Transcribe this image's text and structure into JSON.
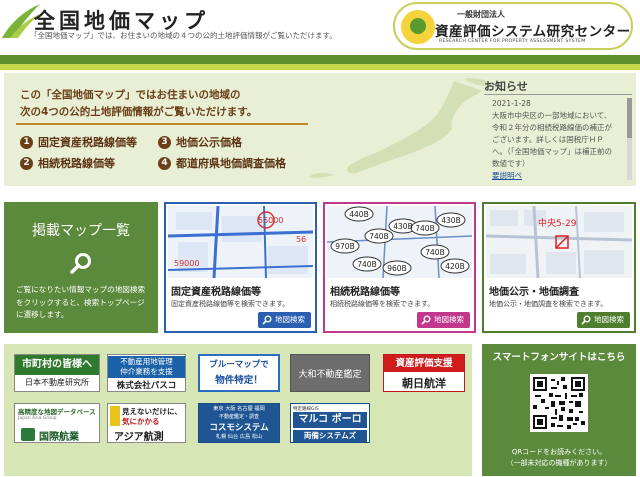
{
  "header": {
    "title": "全国地価マップ",
    "subtitle": "「全国地価マップ」では、お住まいの地域の４つの公的土地評価情報がご覧いただけます。",
    "org": {
      "small": "一般財団法人",
      "name": "資産評価システム研究センター",
      "english": "RESEARCH CENTER FOR PROPERTY ASSESSMENT SYSTEM"
    }
  },
  "hero": {
    "lead_line1": "この「全国地価マップ」ではお住まいの地域の",
    "lead_line2": "次の4つの公的土地評価情報がご覧いただけます。",
    "items": [
      {
        "num": "1",
        "label": "固定資産税路線価等"
      },
      {
        "num": "2",
        "label": "相続税路線価等"
      },
      {
        "num": "3",
        "label": "地価公示価格"
      },
      {
        "num": "4",
        "label": "都道府県地価調査価格"
      }
    ]
  },
  "news": {
    "title": "お知らせ",
    "date": "2021-1-28",
    "body": "大阪市中央区の一部地域において、令和２年分の相続税路線価の補正がございます。詳しくは国税庁ＨＰへ。（「全国地価マップ」は補正前の数値です）",
    "more": "要説明ペ"
  },
  "map_list": {
    "title": "掲載マップ一覧",
    "description": "ご覧になりたい情報マップの地図検索をクリックすると、検索トップページに遷移します。"
  },
  "cards": [
    {
      "title": "固定資産税路線価等",
      "desc": "固定資産税路線価等を検索できます。",
      "button": "地図検索",
      "color": "#2b5fb0",
      "labels": [
        "55000",
        "56",
        "59000"
      ]
    },
    {
      "title": "相続税路線価等",
      "desc": "相続税路線価等を検索できます。",
      "button": "地図検索",
      "color": "#c2388d",
      "labels": [
        "440B",
        "430B",
        "740B",
        "970B",
        "740B",
        "430B",
        "740B",
        "960B",
        "740B",
        "420B"
      ]
    },
    {
      "title": "地価公示・地価調査",
      "desc": "地価公示・地価調査を検索できます。",
      "button": "地図検索",
      "color": "#4f7f2e",
      "labels": [
        "中央5-29"
      ]
    }
  ],
  "banners": {
    "b1": {
      "title": "市町村の皆様へ",
      "sub": "日本不動産研究所"
    },
    "b2": {
      "line1": "不動産用地管理",
      "line2": "仲介業務を支援",
      "line3": "株式会社パスコ"
    },
    "b3": {
      "line1": "ブルーマップで",
      "line2": "物件特定！"
    },
    "b4": {
      "text": "大和不動産鑑定"
    },
    "b5": {
      "line1": "資産評価支援",
      "line2": "朝日航洋"
    },
    "b6": {
      "line1": "高精度な地図データベース",
      "line2": "Japan Asia Group",
      "line3": "国際航業"
    },
    "b7": {
      "line1": "見えないだけに、",
      "line2": "気にかかる",
      "line3": "アジア航測"
    },
    "b8": {
      "line0": "東京 大阪 名古屋 福岡",
      "line1": "不動産鑑定・調査",
      "line2": "コスモシステム",
      "line3": "札幌 仙台 広島 松山"
    },
    "b9": {
      "line0": "特定路線GIS",
      "line1": "マルコ ポーロ",
      "line2": "両備システムズ"
    }
  },
  "smartphone": {
    "title": "スマートフォンサイトはこちら",
    "note1": "QRコードをお読みください。",
    "note2": "（一部未対応の機種があります）"
  },
  "colors": {
    "dark_green": "#5e8f2d",
    "lime": "#c3d84a",
    "hero_bg": "#e8efd4",
    "brown": "#6b3f18",
    "panel_green": "#5b8a3c"
  }
}
